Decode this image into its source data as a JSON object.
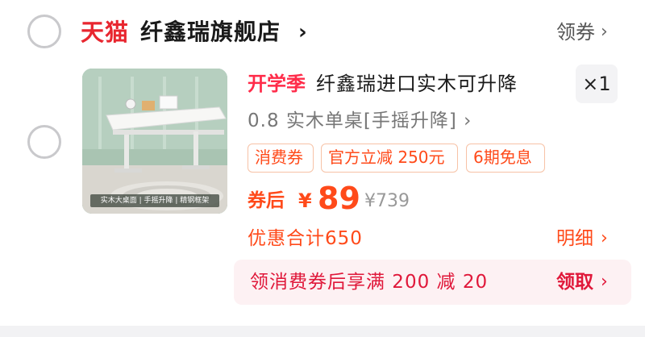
{
  "shop": {
    "badge": "天猫",
    "name": "纤鑫瑞旗舰店",
    "chevron": "›",
    "coupon_link": "领券",
    "coupon_chevron": "›"
  },
  "item": {
    "season_tag": "开学季",
    "title": "纤鑫瑞进口实木可升降",
    "quantity": "×1",
    "spec": "0.8 实木单桌[手摇升降] ›",
    "thumbnail_caption": "实木大桌面 | 手摇升降 | 精钢框架",
    "chips": [
      "消费券",
      "官方立减 250元",
      "6期免息"
    ],
    "price_label": "券后",
    "price_currency": "¥",
    "price_value": "89",
    "price_original": "¥739",
    "discount_total": "优惠合计650",
    "detail_link": "明细",
    "detail_chevron": "›"
  },
  "promo": {
    "text": "领消费券后享满 200 减 20",
    "action": "领取",
    "chevron": "›"
  },
  "colors": {
    "brand_red": "#e8262f",
    "price_orange": "#ff4a1a",
    "promo_bg": "#fdf1f3",
    "promo_text": "#e0183a"
  }
}
